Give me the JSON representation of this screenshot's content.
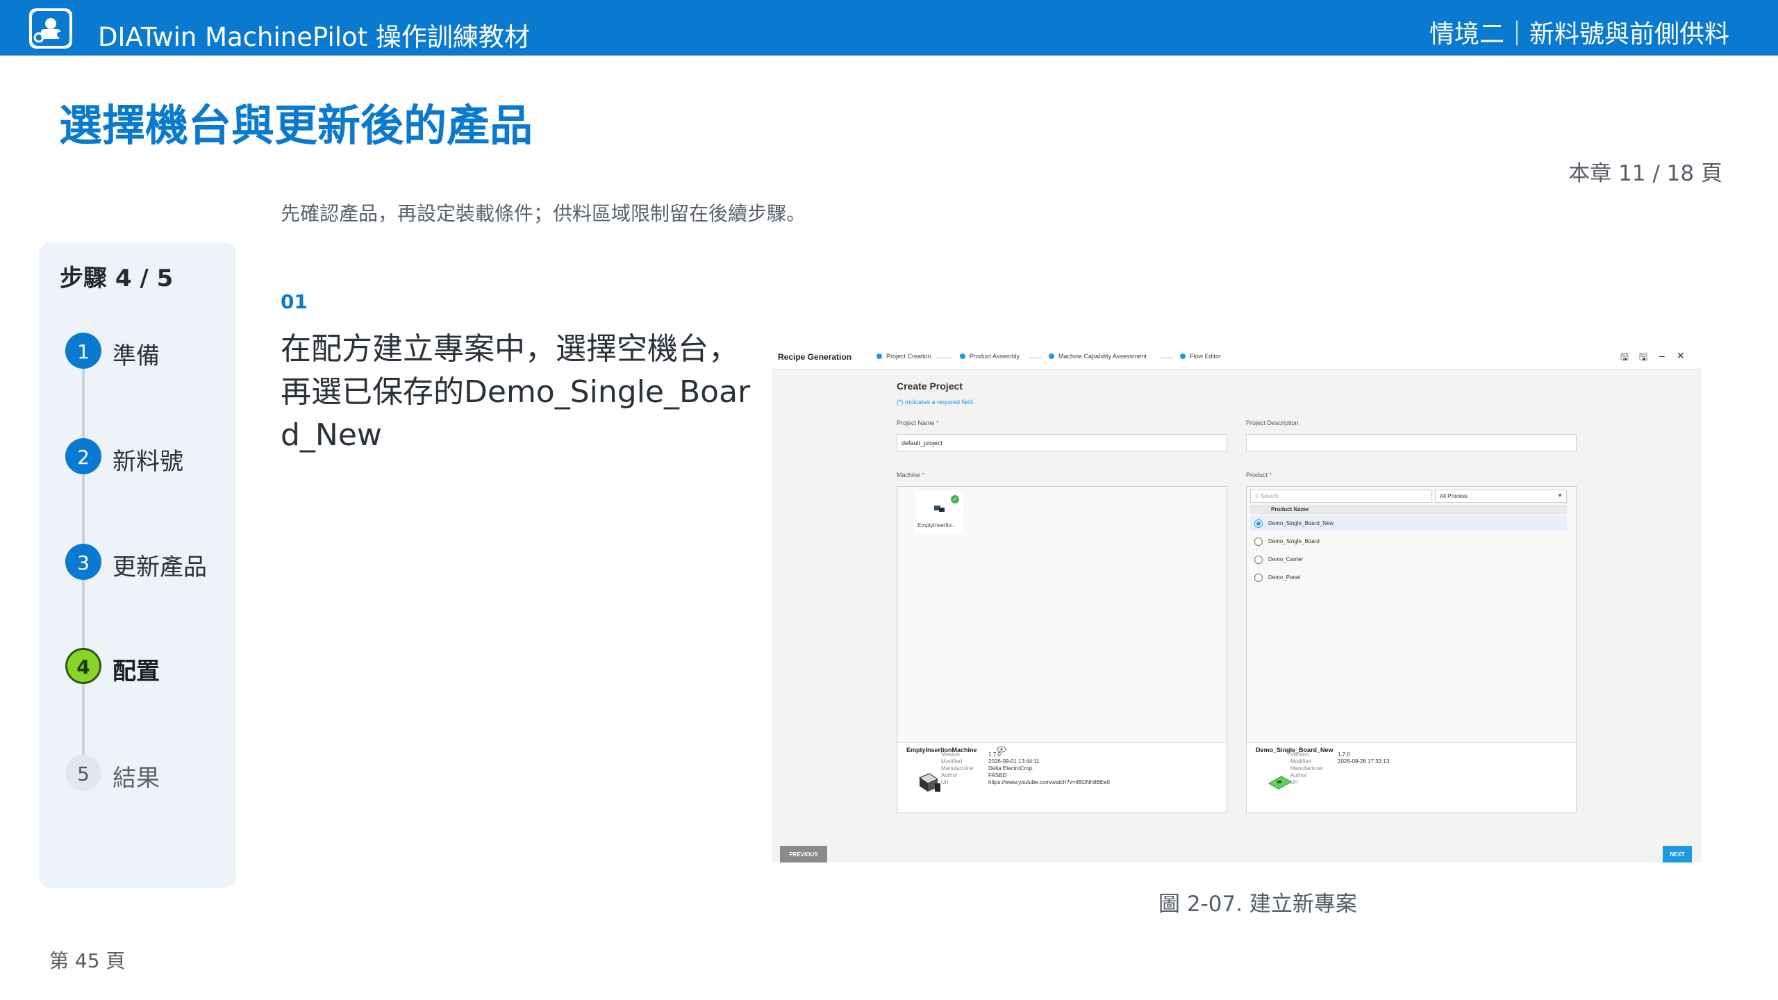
{
  "header": {
    "app_title": "DIATwin MachinePilot 操作訓練教材",
    "chapter_title": "情境二｜新料號與前側供料",
    "logo_icon": "robot-arm-logo-icon"
  },
  "page": {
    "heading": "選擇機台與更新後的產品",
    "chapter_page": "本章 11 / 18 頁",
    "intro": "先確認產品，再設定裝載條件；供料區域限制留在後續步驟。",
    "footer_page": "第 45 頁",
    "caption": "圖 2-07. 建立新專案"
  },
  "steps": {
    "title": "步驟 4 / 5",
    "items": [
      {
        "num": "1",
        "label": "準備",
        "state": "done"
      },
      {
        "num": "2",
        "label": "新料號",
        "state": "done"
      },
      {
        "num": "3",
        "label": "更新產品",
        "state": "done"
      },
      {
        "num": "4",
        "label": "配置",
        "state": "active"
      },
      {
        "num": "5",
        "label": "結果",
        "state": "pending"
      }
    ]
  },
  "content": {
    "step_no": "01",
    "instruction": "在配方建立專案中，選擇空機台，再選已保存的Demo_Single_Board_New"
  },
  "screenshot": {
    "title": "Recipe Generation",
    "wizard": [
      "Project Creation",
      "Product Assembly",
      "Machine Capability Assessment",
      "Flow Editor"
    ],
    "form_title": "Create Project",
    "required_note": "(*) Indicates a required field.",
    "project_name_label": "Project Name",
    "project_name_value": "default_project",
    "project_desc_label": "Project Description",
    "machine_label": "Machine",
    "product_label": "Product",
    "machine_tile_caption": "EmptyInsertio...",
    "search_placeholder": "Search",
    "process_filter": "All Process",
    "product_col_header": "Product Name",
    "products": [
      {
        "name": "Demo_Single_Board_New",
        "selected": true
      },
      {
        "name": "Demo_Single_Board",
        "selected": false
      },
      {
        "name": "Demo_Carrier",
        "selected": false
      },
      {
        "name": "Demo_Panel",
        "selected": false
      }
    ],
    "machine_detail": {
      "name": "EmptyInsertionMachine",
      "rows": [
        {
          "k": "Version",
          "v": "1.7.0"
        },
        {
          "k": "Modified",
          "v": "2026-09-01 13:44:11"
        },
        {
          "k": "Manufacturer",
          "v": "Delta ElectroCrop."
        },
        {
          "k": "Author",
          "v": "FASBD"
        },
        {
          "k": "Url",
          "v": "https://www.youtube.com/watch?v=4BDNh8BEe0"
        }
      ]
    },
    "product_detail": {
      "name": "Demo_Single_Board_New",
      "rows": [
        {
          "k": "Version",
          "v": "1.7.0"
        },
        {
          "k": "Modified",
          "v": "2026-09-28 17:32:13"
        },
        {
          "k": "Manufacturer",
          "v": ""
        },
        {
          "k": "Author",
          "v": ""
        },
        {
          "k": "Url",
          "v": ""
        }
      ]
    },
    "prev_label": "PREVIOUS",
    "next_label": "NEXT"
  }
}
